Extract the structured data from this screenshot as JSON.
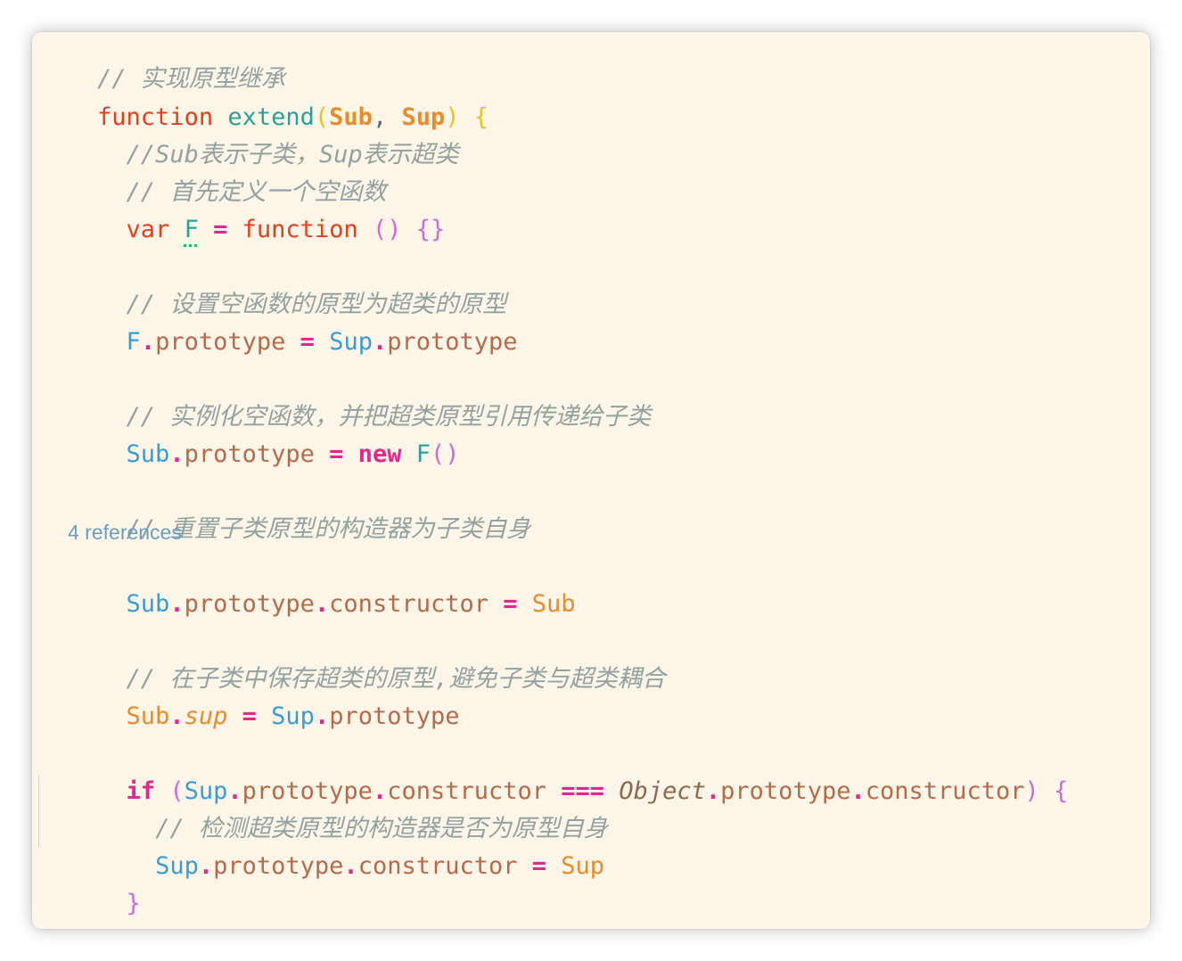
{
  "editor": {
    "comment_title": "// 实现原型继承",
    "kw_function": "function",
    "fn_name": "extend",
    "param_sub": "Sub",
    "param_sup": "Sup",
    "comment_1": "//Sub表示子类，Sup表示超类",
    "comment_2": "// 首先定义一个空函数",
    "kw_var": "var",
    "var_f": "F",
    "comment_3": "// 设置空函数的原型为超类的原型",
    "comment_4": "// 实例化空函数，并把超类原型引用传递给子类",
    "kw_new": "new",
    "comment_5": "// 重置子类原型的构造器为子类自身",
    "codelens": "4 references",
    "comment_6": "// 在子类中保存超类的原型,避免子类与超类耦合",
    "prop_sup": "sup",
    "kw_if": "if",
    "global_object": "Object",
    "op_strict_equal": "===",
    "comment_7": "// 检测超类原型的构造器是否为原型自身",
    "prop_prototype": "prototype",
    "prop_constructor": "constructor"
  },
  "colors": {
    "background": "#fdf6e8",
    "comment": "#93a1a1",
    "keyword": "#e0401c",
    "function_name": "#2aa198",
    "identifier": "#3c9bd6",
    "parameter": "#e98b2a",
    "property": "#b36b4a",
    "operator": "#e0288d"
  }
}
